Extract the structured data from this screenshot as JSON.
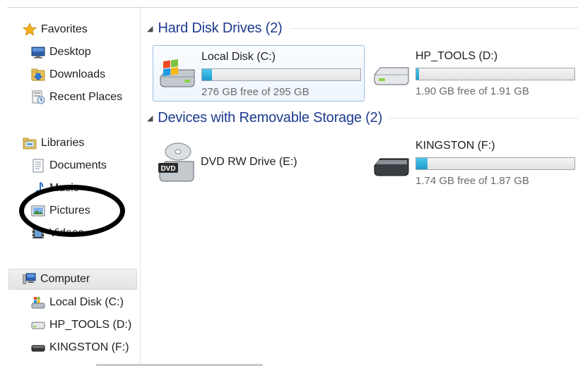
{
  "nav": {
    "favorites": {
      "label": "Favorites",
      "icon": "star-icon"
    },
    "favorites_items": [
      {
        "label": "Desktop",
        "icon": "desktop-icon"
      },
      {
        "label": "Downloads",
        "icon": "downloads-folder-icon"
      },
      {
        "label": "Recent Places",
        "icon": "recent-places-icon"
      }
    ],
    "libraries": {
      "label": "Libraries",
      "icon": "libraries-icon"
    },
    "libraries_items": [
      {
        "label": "Documents",
        "icon": "documents-icon"
      },
      {
        "label": "Music",
        "icon": "music-icon"
      },
      {
        "label": "Pictures",
        "icon": "pictures-icon"
      },
      {
        "label": "Videos",
        "icon": "videos-icon"
      }
    ],
    "computer": {
      "label": "Computer",
      "icon": "computer-icon"
    },
    "computer_items": [
      {
        "label": "Local Disk (C:)",
        "icon": "local-disk-icon"
      },
      {
        "label": "HP_TOOLS (D:)",
        "icon": "drive-icon"
      },
      {
        "label": "KINGSTON (F:)",
        "icon": "usb-drive-icon"
      }
    ]
  },
  "groups": {
    "hard_disks": {
      "label": "Hard Disk Drives (2)"
    },
    "removable": {
      "label": "Devices with Removable Storage (2)"
    }
  },
  "drives": {
    "c": {
      "name": "Local Disk (C:)",
      "free": "276 GB free of 295 GB",
      "used_fraction": 0.064
    },
    "d": {
      "name": "HP_TOOLS (D:)",
      "free": "1.90 GB free of 1.91 GB",
      "used_fraction": 0.006
    },
    "e": {
      "name": "DVD RW Drive (E:)",
      "badge": "DVD"
    },
    "f": {
      "name": "KINGSTON (F:)",
      "free": "1.74 GB free of 1.87 GB",
      "used_fraction": 0.07
    }
  },
  "colors": {
    "group_header": "#1e3b8f",
    "bar_fill": "#1c9bd0",
    "selection_border": "#9cbde0"
  }
}
